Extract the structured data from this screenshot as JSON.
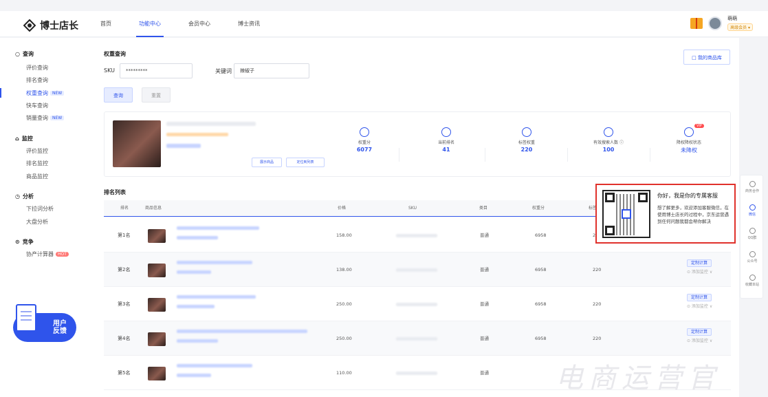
{
  "header": {
    "logo_text": "博士店长",
    "nav": [
      "首页",
      "功能中心",
      "会员中心",
      "博士资讯"
    ],
    "active_nav": 1,
    "user_name": "萌萌",
    "user_badge": "高级会员 ▾"
  },
  "sidebar": {
    "sections": [
      {
        "title": "查询",
        "items": [
          {
            "label": "评价查询"
          },
          {
            "label": "排名查询"
          },
          {
            "label": "权重查询",
            "tag": "NEW",
            "active": true
          },
          {
            "label": "快车查询"
          },
          {
            "label": "销量查询",
            "tag": "NEW"
          }
        ]
      },
      {
        "title": "监控",
        "items": [
          {
            "label": "评价监控"
          },
          {
            "label": "排名监控"
          },
          {
            "label": "商品监控"
          }
        ]
      },
      {
        "title": "分析",
        "items": [
          {
            "label": "下拉词分析"
          },
          {
            "label": "大盘分析"
          }
        ]
      },
      {
        "title": "竞争",
        "items": [
          {
            "label": "协产计算器",
            "tag": "HOT"
          }
        ]
      }
    ],
    "feedback_line1": "用户",
    "feedback_line2": "反馈"
  },
  "query": {
    "section_title": "权重查询",
    "sku_label": "SKU",
    "sku_value": "*********",
    "keyword_label": "关键词",
    "keyword_value": "辣椒子",
    "query_button": "查询",
    "reset_button": "重置",
    "store_button": "我的商品库"
  },
  "product_card": {
    "btn_display": "展示商品",
    "btn_list": "定位到列表",
    "stats": [
      {
        "label": "权重分",
        "value": "6077"
      },
      {
        "label": "当前排名",
        "value": "41"
      },
      {
        "label": "标签权重",
        "value": "220"
      },
      {
        "label": "有效搜索人数 ⓘ",
        "value": "100"
      },
      {
        "label": "降权降权状态",
        "value": "未降权"
      }
    ],
    "vip_badge": "VIP"
  },
  "ranking": {
    "section_title": "排名列表",
    "columns": [
      "排名",
      "商品信息",
      "价格",
      "SKU",
      "类目",
      "权重分",
      "标签权重",
      "",
      "操作"
    ],
    "rows": [
      {
        "rank": "第1名",
        "price": "158.00",
        "category": "普通",
        "weight": "6958",
        "tag_weight": "220"
      },
      {
        "rank": "第2名",
        "price": "138.00",
        "category": "普通",
        "weight": "6958",
        "tag_weight": "220"
      },
      {
        "rank": "第3名",
        "price": "250.00",
        "category": "普通",
        "weight": "6958",
        "tag_weight": "220"
      },
      {
        "rank": "第4名",
        "price": "250.00",
        "category": "普通",
        "weight": "6958",
        "tag_weight": "220"
      },
      {
        "rank": "第5名",
        "price": "110.00",
        "category": "普通",
        "weight": "6958",
        "tag_weight": ""
      }
    ],
    "action_calc": "定制计算",
    "action_monitor": "⊙ 添加监控 ∨"
  },
  "popup": {
    "title": "你好，我是你的专属客服",
    "text": "想了解更多，欢迎添加客服微信，在使用博士店长的过程中，京东运营遇到任何问题我都会帮你解决"
  },
  "right_bar": [
    "商务合作",
    "微信",
    "QQ群",
    "公众号",
    "收藏本站"
  ],
  "watermark": "电商运营官"
}
